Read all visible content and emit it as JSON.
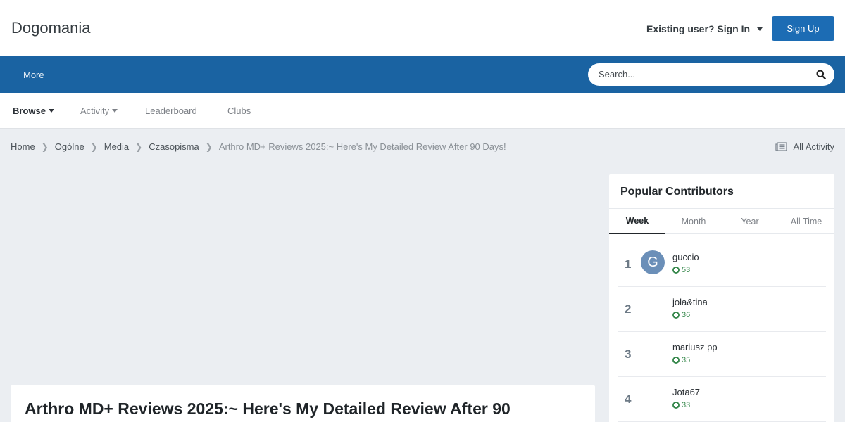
{
  "header": {
    "site_title": "Dogomania",
    "signin_label": "Existing user? Sign In",
    "signup_label": "Sign Up"
  },
  "navbar": {
    "more_label": "More",
    "search_placeholder": "Search..."
  },
  "subnav": {
    "items": [
      {
        "label": "Browse",
        "active": true,
        "dropdown": true
      },
      {
        "label": "Activity",
        "active": false,
        "dropdown": true
      },
      {
        "label": "Leaderboard",
        "active": false,
        "dropdown": false
      },
      {
        "label": "Clubs",
        "active": false,
        "dropdown": false
      }
    ]
  },
  "breadcrumb": {
    "items": [
      "Home",
      "Ogólne",
      "Media",
      "Czasopisma"
    ],
    "current": "Arthro MD+ Reviews 2025:~ Here's My Detailed Review After 90 Days!",
    "all_activity_label": "All Activity"
  },
  "post": {
    "title": "Arthro MD+ Reviews 2025:~ Here's My Detailed Review After 90"
  },
  "widget": {
    "title": "Popular Contributors",
    "tabs": [
      "Week",
      "Month",
      "Year",
      "All Time"
    ],
    "active_tab": "Week",
    "contributors": [
      {
        "rank": "1",
        "name": "guccio",
        "rep": "53",
        "avatar_letter": "G"
      },
      {
        "rank": "2",
        "name": "jola&tina",
        "rep": "36",
        "avatar_letter": ""
      },
      {
        "rank": "3",
        "name": "mariusz pp",
        "rep": "35",
        "avatar_letter": ""
      },
      {
        "rank": "4",
        "name": "Jota67",
        "rep": "33",
        "avatar_letter": ""
      }
    ]
  },
  "colors": {
    "brand": "#1a63a2",
    "signup": "#1c6cb4",
    "background": "#ebeef2",
    "reputation": "#3a8a4f"
  },
  "icons": {
    "search": "search-icon",
    "all_activity": "newspaper-icon",
    "breadcrumb_separator": "chevron-right-icon",
    "dropdown": "caret-down-icon",
    "reputation": "plus-circle-icon"
  }
}
